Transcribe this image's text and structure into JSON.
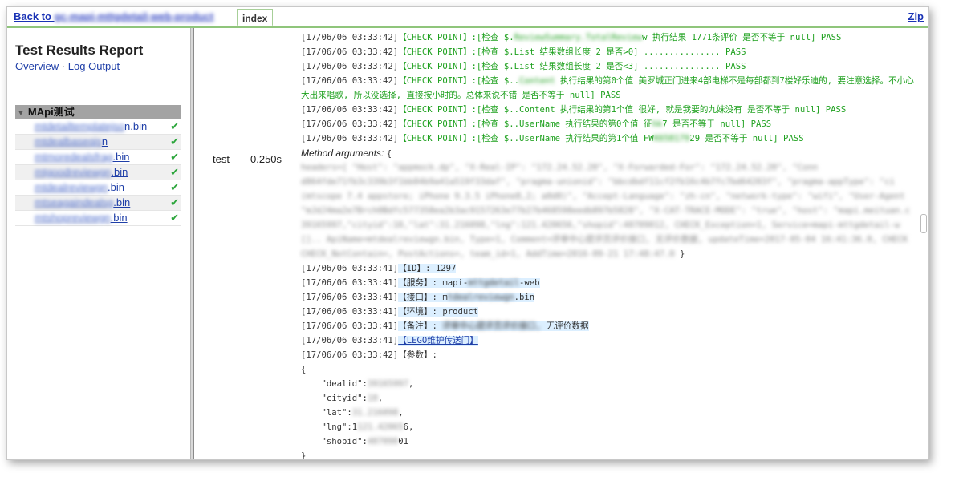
{
  "topbar": {
    "back_prefix": "Back to ",
    "back_blurred": "gc-mapi-mttgdetail-web-product",
    "index_tab": "index",
    "zip_label": "Zip"
  },
  "sidebar": {
    "title": "Test Results Report",
    "overview_link": "Overview",
    "separator": "·",
    "log_link": "Log Output",
    "suite_name": "MApi测试",
    "files": [
      {
        "blurred": "mtdetailtemplatejso",
        "suffix": "n.bin"
      },
      {
        "blurred": "mtdealbaseqjs",
        "suffix": "n"
      },
      {
        "blurred": "mtmoredealsfrag",
        "suffix": ".bin"
      },
      {
        "blurred": "mtgoodreviewgn",
        "suffix": ".bin"
      },
      {
        "blurred": "mtdealreviewgn",
        "suffix": ".bin"
      },
      {
        "blurred": "mtseagaindealsg",
        "suffix": ".bin"
      },
      {
        "blurred": "mtshopreviewgn",
        "suffix": ".bin"
      }
    ]
  },
  "test": {
    "name": "test",
    "duration": "0.250s"
  },
  "log": {
    "check_lines": [
      {
        "ts": "[17/06/06 03:33:42]",
        "pre": "【CHECK POINT】:[检查 $.",
        "blur": "ReviewSummary.TotalReview",
        "post": "w 执行结果 1771条评价 是否不等于 null] PASS"
      },
      {
        "ts": "[17/06/06 03:33:42]",
        "pre": "【CHECK POINT】:[检查 $.List 结果数组长度 2 是否>0] ............... PASS",
        "blur": "",
        "post": ""
      },
      {
        "ts": "[17/06/06 03:33:42]",
        "pre": "【CHECK POINT】:[检查 $.List 结果数组长度 2 是否<3] ............... PASS",
        "blur": "",
        "post": ""
      },
      {
        "ts": "[17/06/06 03:33:42]",
        "pre": "【CHECK POINT】:[检查 $..",
        "blur": "Content",
        "post": " 执行结果的第0个值 美罗城正门进来4部电梯不是每部都到7楼好乐迪的, 要注意选择。不小心"
      }
    ],
    "wrap_line": "大出来唱歌, 所以没选择, 直接按小时的。总体来说不错 是否不等于 null] PASS",
    "check_lines2": [
      {
        "ts": "[17/06/06 03:33:42]",
        "pre": "【CHECK POINT】:[检查 $..Content 执行结果的第1个值 很好, 就是我要的九妹没有 是否不等于 null] PASS",
        "blur": "",
        "post": ""
      },
      {
        "ts": "[17/06/06 03:33:42]",
        "pre": "【CHECK POINT】:[检查 $..UserName 执行结果的第0个值 征",
        "blur": "hk",
        "post": "7 是否不等于 null] PASS"
      },
      {
        "ts": "[17/06/06 03:33:42]",
        "pre": "【CHECK POINT】:[检查 $..UserName 执行结果的第1个值 FW",
        "blur": "K658179",
        "post": "29 是否不等于 null] PASS"
      }
    ],
    "method_label": "Method arguments: ",
    "method_open": "{",
    "method_blur_lines": [
      "headers={ \"Host\": \"appmock.dp\", \"X-Real-IP\": \"172.24.52.20\", \"X-Forwarded-For\": \"172.24.52.20\", \"Conn",
      "d864fde71fb3c339b3f1bb84b9a41a519f33daf\", \"pragma-unionid\": \"bbcdbdf11cf2fb16c4b7fc7bd64203f\", \"pragma-appType\": \"ci",
      "(mtscope 7.4 appstore; iPhone 9.3.5 iPhone8,2; a0d0)\", \"Accept-Language\": \"zh-cn\", \"network-type\": \"wifi\", \"User-Agent",
      "\"mJdJ4ma2e7Brch0Bdfc577358ea2b3ac9157263e77b27b468598eedb897b5828\", \"X-CAT-TRACE-MODE\": \"true\", \"host\": \"mapi.meituan.c",
      "39165997,\"cityid\":10,\"lat\":31.216098,\"lng\":121.420656,\"shopid\":40709012, CHECK_Exception=1, Service=mapi-mttgdetail-w",
      "[].. ApiName=mtdealreviewgn.bin, Type=1, Comment=评审中心提评页评价接口, 无评价数据, updateTime=2017-05-04 16:41:36.0, CHECK",
      "CHECK_NotContain=, PostActions=, team_id=1, AddTime=2016-09-21 17:48:47.0"
    ],
    "method_close": "}",
    "info_lines": [
      {
        "ts": "[17/06/06 03:33:41]",
        "text": "【ID】: 1297",
        "blur": "",
        "post": ""
      },
      {
        "ts": "[17/06/06 03:33:41]",
        "text": "【服务】: mapi-",
        "blur": "mttgdetail",
        "post": "-web"
      },
      {
        "ts": "[17/06/06 03:33:41]",
        "text": "【接口】: m",
        "blur": "tdealreviewgn",
        "post": ".bin"
      },
      {
        "ts": "[17/06/06 03:33:41]",
        "text": "【环境】: product",
        "blur": "",
        "post": ""
      },
      {
        "ts": "[17/06/06 03:33:41]",
        "text": "【备注】: ",
        "blur": "评审中心提评页评价接口, ",
        "post": "无评价数据"
      }
    ],
    "lego_ts": "[17/06/06 03:33:41]",
    "lego_link": "【LEGO维护传送门】",
    "params_ts": "[17/06/06 03:33:42]",
    "params_label": "【参数】:",
    "json_open": "{",
    "params": [
      {
        "key": "\"dealid\"",
        "blur": "39165997",
        "post": ","
      },
      {
        "key": "\"cityid\"",
        "blur": "10",
        "post": ","
      },
      {
        "key": "\"lat\"",
        "blur": "31.216098",
        "post": ","
      },
      {
        "key": "\"lng\"",
        "blur": "121.42065",
        "post": "6,",
        "pre_visible": "1"
      },
      {
        "key": "\"shopid\"",
        "blur": "407090",
        "post": "01"
      }
    ],
    "json_close": "}"
  }
}
